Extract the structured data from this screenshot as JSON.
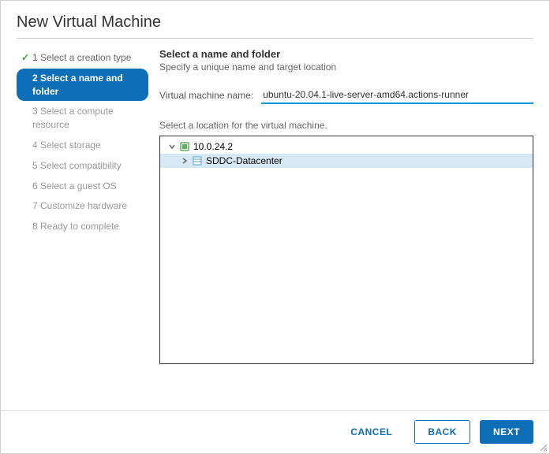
{
  "dialog": {
    "title": "New Virtual Machine"
  },
  "steps": [
    {
      "label": "1 Select a creation type",
      "state": "done"
    },
    {
      "label": "2 Select a name and folder",
      "state": "active"
    },
    {
      "label": "3 Select a compute resource",
      "state": "pending"
    },
    {
      "label": "4 Select storage",
      "state": "pending"
    },
    {
      "label": "5 Select compatibility",
      "state": "pending"
    },
    {
      "label": "6 Select a guest OS",
      "state": "pending"
    },
    {
      "label": "7 Customize hardware",
      "state": "pending"
    },
    {
      "label": "8 Ready to complete",
      "state": "pending"
    }
  ],
  "main": {
    "heading": "Select a name and folder",
    "subheading": "Specify a unique name and target location",
    "vmname_label": "Virtual machine name:",
    "vmname_value": "ubuntu-20.04.1-live-server-amd64.actions-runner",
    "location_label": "Select a location for the virtual machine."
  },
  "tree": {
    "root": {
      "label": "10.0.24.2"
    },
    "child": {
      "label": "SDDC-Datacenter"
    }
  },
  "footer": {
    "cancel": "CANCEL",
    "back": "BACK",
    "next": "NEXT"
  }
}
